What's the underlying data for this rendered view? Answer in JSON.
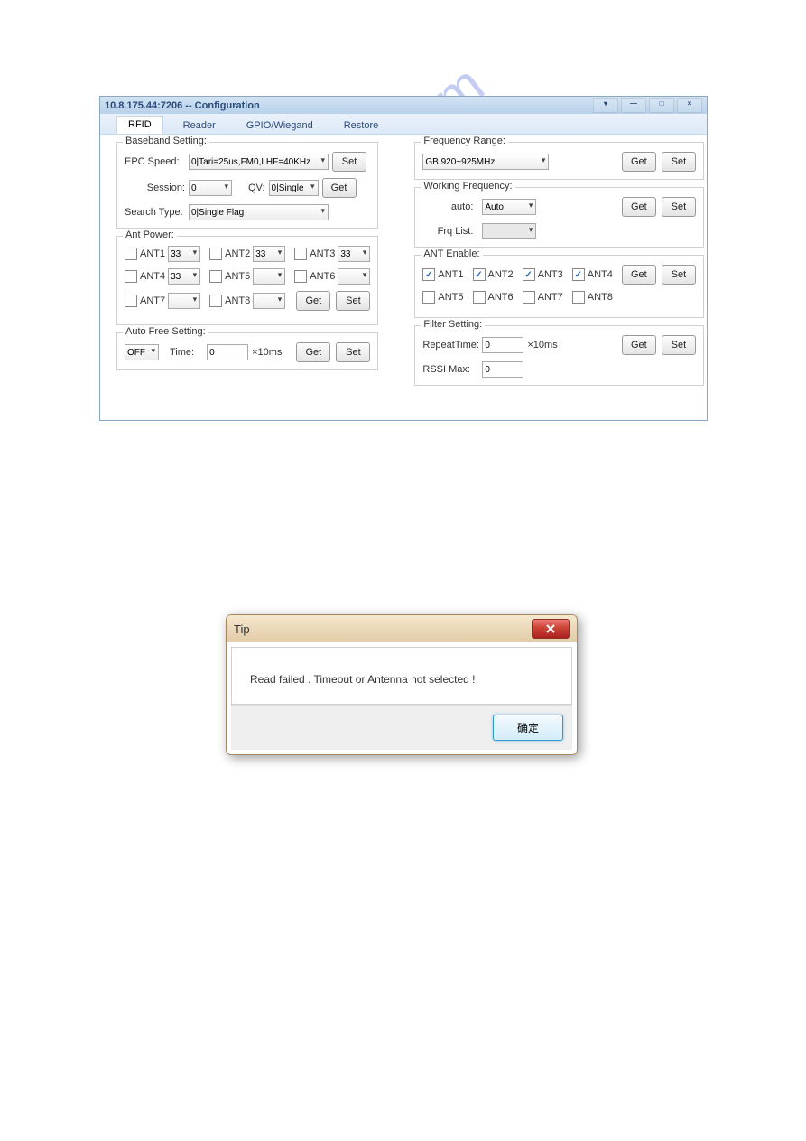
{
  "window": {
    "title": "10.8.175.44:7206 -- Configuration",
    "tabs": [
      "RFID",
      "Reader",
      "GPIO/Wiegand",
      "Restore"
    ],
    "active_tab": 0
  },
  "baseband": {
    "title": "Baseband Setting:",
    "epc_speed_label": "EPC Speed:",
    "epc_speed_value": "0|Tari=25us,FM0,LHF=40KHz",
    "session_label": "Session:",
    "session_value": "0",
    "qv_label": "QV:",
    "qv_value": "0|Single",
    "search_type_label": "Search Type:",
    "search_type_value": "0|Single Flag",
    "set_label": "Set",
    "get_label": "Get"
  },
  "ant_power": {
    "title": "Ant Power:",
    "ants": [
      "ANT1",
      "ANT2",
      "ANT3",
      "ANT4",
      "ANT5",
      "ANT6",
      "ANT7",
      "ANT8"
    ],
    "values": {
      "ANT1": "33",
      "ANT2": "33",
      "ANT3": "33",
      "ANT4": "33",
      "ANT5": "",
      "ANT6": "",
      "ANT7": "",
      "ANT8": ""
    },
    "get_label": "Get",
    "set_label": "Set"
  },
  "auto_free": {
    "title": "Auto Free Setting:",
    "off_value": "OFF",
    "time_label": "Time:",
    "time_value": "0",
    "unit": "×10ms",
    "get_label": "Get",
    "set_label": "Set"
  },
  "freq_range": {
    "title": "Frequency Range:",
    "value": "GB,920~925MHz",
    "get_label": "Get",
    "set_label": "Set"
  },
  "working_freq": {
    "title": "Working Frequency:",
    "auto_label": "auto:",
    "auto_value": "Auto",
    "frq_list_label": "Frq List:",
    "get_label": "Get",
    "set_label": "Set"
  },
  "ant_enable": {
    "title": "ANT Enable:",
    "ants": [
      {
        "name": "ANT1",
        "checked": true
      },
      {
        "name": "ANT2",
        "checked": true
      },
      {
        "name": "ANT3",
        "checked": true
      },
      {
        "name": "ANT4",
        "checked": true
      },
      {
        "name": "ANT5",
        "checked": false
      },
      {
        "name": "ANT6",
        "checked": false
      },
      {
        "name": "ANT7",
        "checked": false
      },
      {
        "name": "ANT8",
        "checked": false
      }
    ],
    "get_label": "Get",
    "set_label": "Set"
  },
  "filter": {
    "title": "Filter Setting:",
    "repeat_label": "RepeatTime:",
    "repeat_value": "0",
    "repeat_unit": "×10ms",
    "rssi_label": "RSSI Max:",
    "rssi_value": "0",
    "get_label": "Get",
    "set_label": "Set"
  },
  "dialog": {
    "title": "Tip",
    "message": "Read failed . Timeout or Antenna not selected !",
    "ok_label": "确定"
  },
  "watermark": "manualshive.com"
}
